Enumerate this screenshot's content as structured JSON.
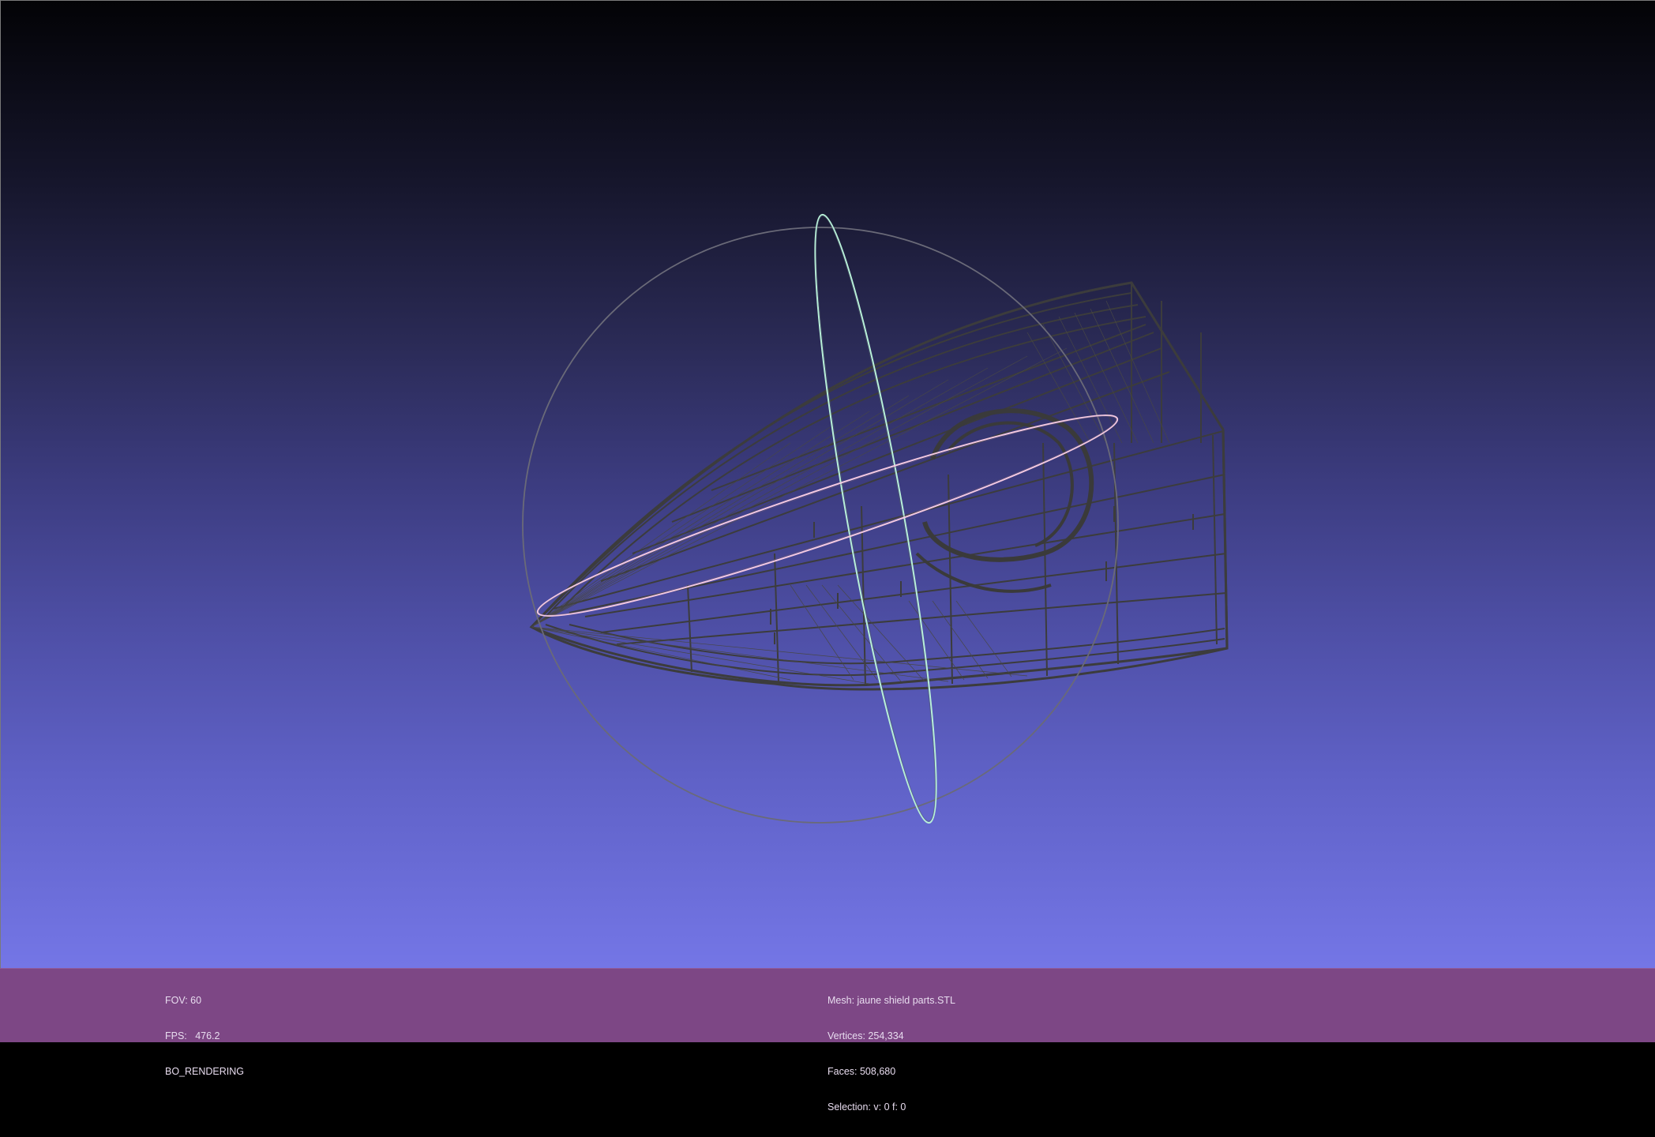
{
  "left_info": {
    "fov": "FOV: 60",
    "fps": "FPS:   476.2",
    "mode": "BO_RENDERING"
  },
  "mesh_info": {
    "mesh": "Mesh: jaune shield parts.STL",
    "vertices": "Vertices: 254,334",
    "faces": "Faces: 508,680",
    "selection": "Selection: v: 0 f: 0"
  },
  "colors": {
    "background_top": "#030306",
    "background_bottom": "#7476e6",
    "info_bar": "#7d4785",
    "wireframe": "#3c3c3c",
    "trackball_sphere": "#6a6a78",
    "trackball_vertical_ring": "#b8f0d8",
    "trackball_horizontal_ring": "#f2c8e0"
  },
  "icons": {
    "trackball": "trackball-gizmo",
    "mesh": "wireframe-mesh"
  }
}
